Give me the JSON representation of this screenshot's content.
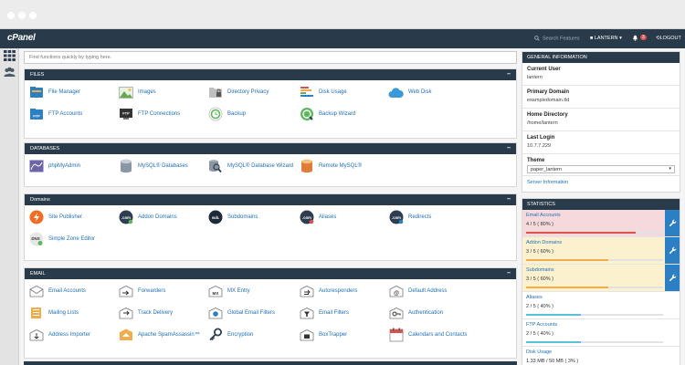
{
  "browser": {
    "dots": 3
  },
  "topbar": {
    "logo": "cPanel",
    "search_placeholder": "Search Features",
    "user": "LANTERN",
    "notifications": "3",
    "logout": "LOGOUT"
  },
  "main": {
    "search_placeholder": "Find functions quickly by typing here.",
    "sections": [
      {
        "title": "FILES",
        "items": [
          {
            "label": "File Manager",
            "icon": "file-manager-icon"
          },
          {
            "label": "Images",
            "icon": "images-icon"
          },
          {
            "label": "Directory Privacy",
            "icon": "directory-privacy-icon"
          },
          {
            "label": "Disk Usage",
            "icon": "disk-usage-icon"
          },
          {
            "label": "Web Disk",
            "icon": "web-disk-icon"
          },
          {
            "label": "FTP Accounts",
            "icon": "ftp-accounts-icon"
          },
          {
            "label": "FTP Connections",
            "icon": "ftp-connections-icon"
          },
          {
            "label": "Backup",
            "icon": "backup-icon"
          },
          {
            "label": "Backup Wizard",
            "icon": "backup-wizard-icon"
          }
        ]
      },
      {
        "title": "DATABASES",
        "items": [
          {
            "label": "phpMyAdmin",
            "icon": "phpmyadmin-icon"
          },
          {
            "label": "MySQL® Databases",
            "icon": "mysql-databases-icon"
          },
          {
            "label": "MySQL® Database Wizard",
            "icon": "mysql-wizard-icon"
          },
          {
            "label": "Remote MySQL®",
            "icon": "remote-mysql-icon"
          }
        ]
      },
      {
        "title": "Domains",
        "items": [
          {
            "label": "Site Publisher",
            "icon": "site-publisher-icon"
          },
          {
            "label": "Addon Domains",
            "icon": "addon-domains-icon",
            "glyph": ".com"
          },
          {
            "label": "Subdomains",
            "icon": "subdomains-icon",
            "glyph": "sub."
          },
          {
            "label": "Aliases",
            "icon": "aliases-icon",
            "glyph": ".com"
          },
          {
            "label": "Redirects",
            "icon": "redirects-icon",
            "glyph": ".com"
          },
          {
            "label": "Simple Zone Editor",
            "icon": "zone-editor-icon",
            "glyph": "DNS"
          }
        ]
      },
      {
        "title": "EMAIL",
        "items": [
          {
            "label": "Email Accounts",
            "icon": "email-accounts-icon"
          },
          {
            "label": "Forwarders",
            "icon": "forwarders-icon"
          },
          {
            "label": "MX Entry",
            "icon": "mx-entry-icon",
            "glyph": "MX"
          },
          {
            "label": "Autoresponders",
            "icon": "autoresponders-icon"
          },
          {
            "label": "Default Address",
            "icon": "default-address-icon",
            "glyph": "@"
          },
          {
            "label": "Mailing Lists",
            "icon": "mailing-lists-icon"
          },
          {
            "label": "Track Delivery",
            "icon": "track-delivery-icon"
          },
          {
            "label": "Global Email Filters",
            "icon": "global-filters-icon"
          },
          {
            "label": "Email Filters",
            "icon": "email-filters-icon"
          },
          {
            "label": "Authentication",
            "icon": "authentication-icon"
          },
          {
            "label": "Address Importer",
            "icon": "address-importer-icon"
          },
          {
            "label": "Apache SpamAssassin™",
            "icon": "spamassassin-icon"
          },
          {
            "label": "Encryption",
            "icon": "encryption-icon"
          },
          {
            "label": "BoxTrapper",
            "icon": "boxtrapper-icon"
          },
          {
            "label": "Calendars and Contacts",
            "icon": "calendars-icon"
          }
        ]
      }
    ]
  },
  "general": {
    "title": "GENERAL INFORMATION",
    "rows": [
      {
        "key": "Current User",
        "value": "lantern"
      },
      {
        "key": "Primary Domain",
        "value": "exampledomain.tld"
      },
      {
        "key": "Home Directory",
        "value": "/home/lantern"
      },
      {
        "key": "Last Login",
        "value": "10.7.7.229"
      }
    ],
    "theme_label": "Theme",
    "theme_value": "paper_lantern",
    "server_info": "Server Information"
  },
  "statistics": {
    "title": "STATISTICS",
    "items": [
      {
        "name": "Email Accounts",
        "value": "4 / 5 ( 80% )",
        "percent": 80,
        "level": "danger"
      },
      {
        "name": "Addon Domains",
        "value": "3 / 5 ( 60% )",
        "percent": 60,
        "level": "warning"
      },
      {
        "name": "Subdomains",
        "value": "3 / 5 ( 60% )",
        "percent": 60,
        "level": "warning"
      },
      {
        "name": "Aliases",
        "value": "2 / 5 ( 40% )",
        "percent": 40,
        "level": "ok"
      },
      {
        "name": "FTP Accounts",
        "value": "2 / 5 ( 40% )",
        "percent": 40,
        "level": "ok"
      },
      {
        "name": "Disk Usage",
        "value": "1.33 MB / 50 MB ( 3% )",
        "percent": 3,
        "level": "ok"
      }
    ]
  },
  "colors": {
    "header": "#293a4a",
    "link": "#1f6fb7",
    "danger_bg": "#f6d9dc",
    "danger_bar": "#d9534f",
    "warning_bg": "#fbf1cf",
    "warning_bar": "#f0ad4e",
    "ok_bar": "#5bc0de",
    "wrench": "#2b7fc2"
  }
}
